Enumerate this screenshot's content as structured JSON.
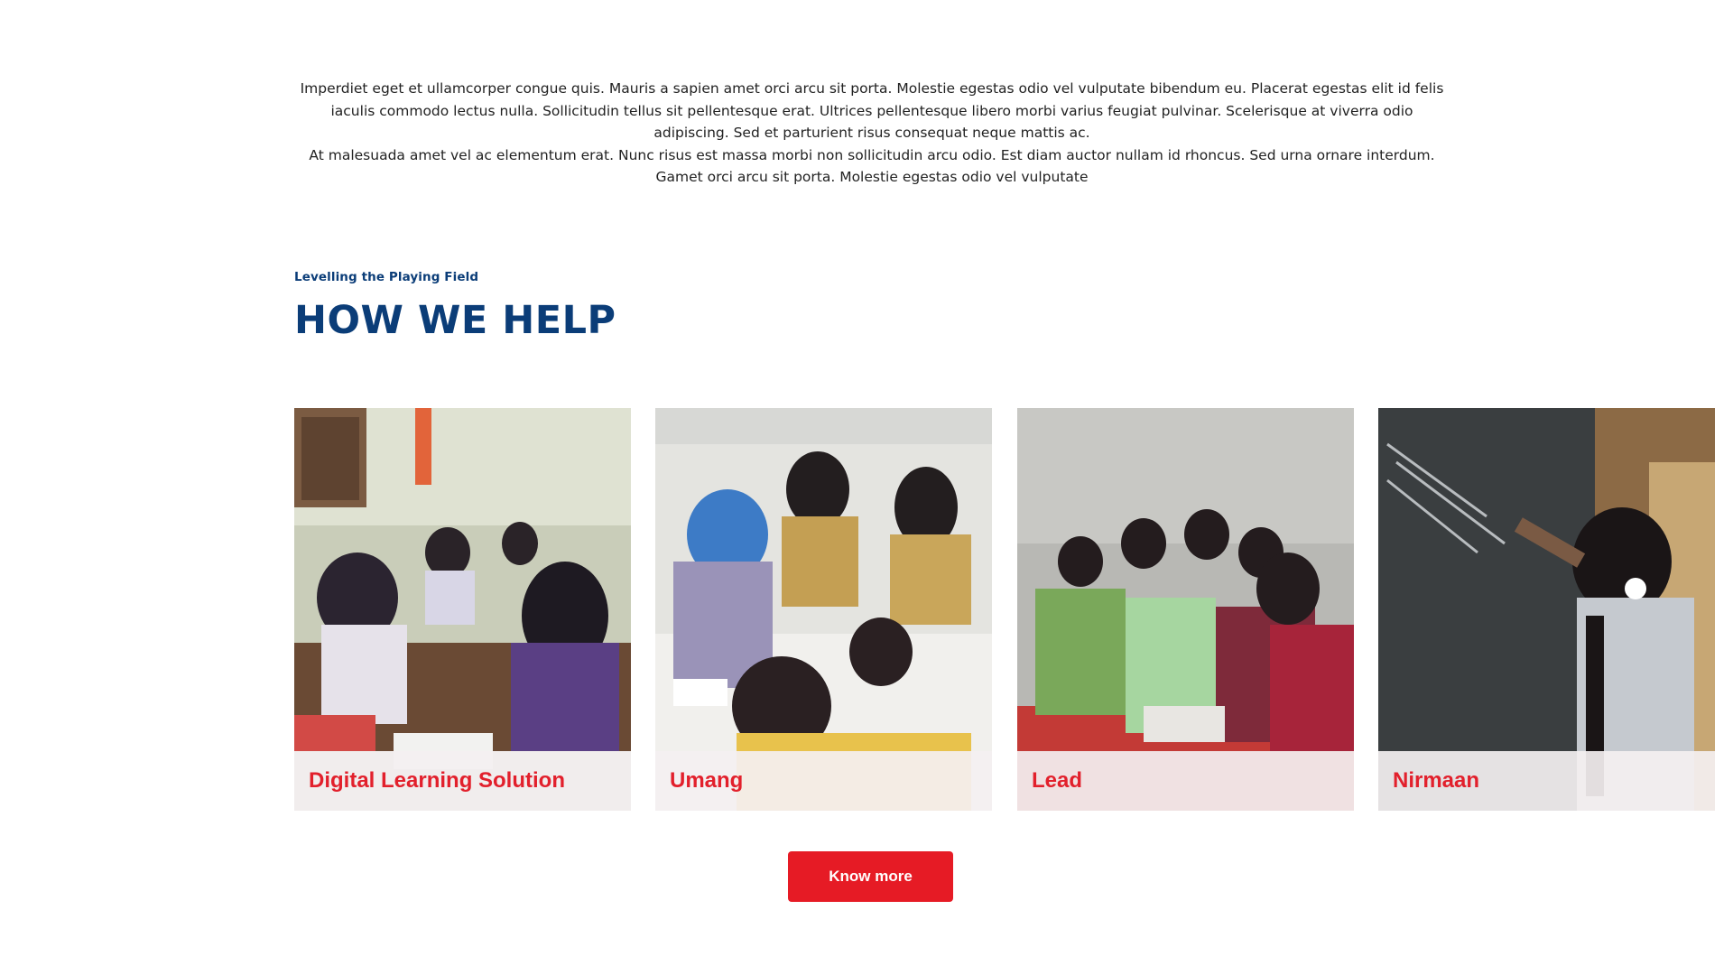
{
  "intro": {
    "paragraph_1": "Imperdiet eget et ullamcorper congue quis. Mauris a sapien amet orci arcu sit porta. Molestie egestas odio vel vulputate bibendum eu. Placerat egestas elit id felis iaculis commodo lectus nulla. Sollicitudin tellus sit pellentesque erat. Ultrices pellentesque libero morbi varius feugiat pulvinar. Scelerisque at viverra odio adipiscing. Sed et parturient risus consequat neque mattis ac.",
    "paragraph_2": "At malesuada amet vel ac elementum erat. Nunc risus est massa morbi non sollicitudin arcu odio. Est diam auctor nullam id rhoncus. Sed urna ornare interdum. Gamet orci arcu sit porta. Molestie egestas odio vel vulputate"
  },
  "section": {
    "eyebrow": "Levelling the  Playing Field",
    "title": "HOW WE HELP"
  },
  "cards": [
    {
      "label": "Digital Learning Solution"
    },
    {
      "label": "Umang"
    },
    {
      "label": "Lead"
    },
    {
      "label": "Nirmaan"
    }
  ],
  "cta": {
    "label": "Know more"
  },
  "colors": {
    "brand_blue": "#0b3d78",
    "brand_red": "#e61b25",
    "caption_text": "#e2202c"
  }
}
